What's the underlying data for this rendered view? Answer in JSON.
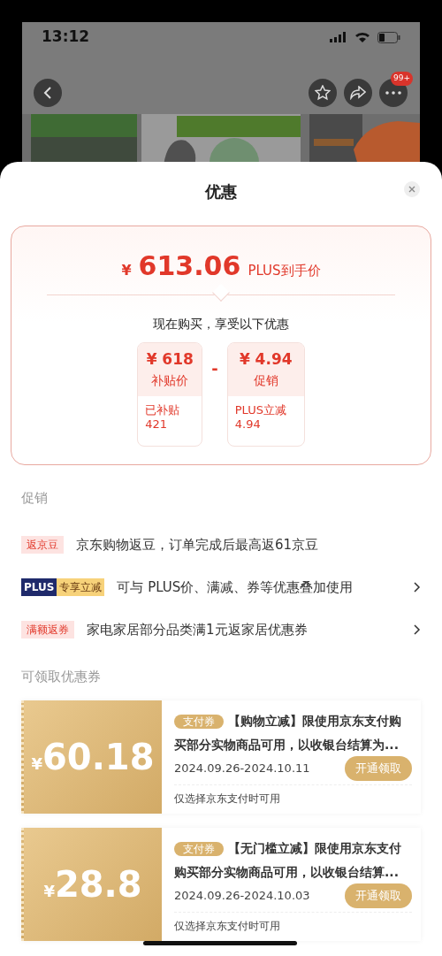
{
  "status_bar": {
    "time": "13:12"
  },
  "product_page": {
    "badge": "99+"
  },
  "sheet": {
    "title": "优惠"
  },
  "price_card": {
    "currency": "¥",
    "price": "613.06",
    "price_label": "PLUS到手价",
    "subtitle": "现在购买，享受以下优惠",
    "operator": "-",
    "items": [
      {
        "amount": "¥ 618",
        "label": "补贴价",
        "detail": "已补贴",
        "detail_value": "421"
      },
      {
        "amount": "¥ 4.94",
        "label": "促销",
        "detail": "PLUS立减",
        "detail_value": "4.94"
      }
    ]
  },
  "promotions": {
    "heading": "促销",
    "items": [
      {
        "kind": "tag",
        "tag": "返京豆",
        "text": "京东购物返豆，订单完成后最高返61京豆",
        "arrow": false
      },
      {
        "kind": "plus",
        "tag": "PLUS",
        "tag2": "专享立减",
        "text": "可与 PLUS价、满减、券等优惠叠加使用",
        "arrow": true
      },
      {
        "kind": "tag",
        "tag": "满额返券",
        "text": "家电家居部分品类满1元返家居优惠券",
        "arrow": true
      }
    ]
  },
  "coupons": {
    "heading": "可领取优惠券",
    "items": [
      {
        "currency": "¥",
        "amount": "60.18",
        "tag": "支付券",
        "title": "【购物立减】限使用京东支付购买部分实物商品可用，以收银台结算为...",
        "date": "2024.09.26-2024.10.11",
        "note": "仅选择京东支付时可用",
        "button": "开通领取"
      },
      {
        "currency": "¥",
        "amount": "28.8",
        "tag": "支付券",
        "title": "【无门槛立减】限使用京东支付购买部分实物商品可用，以收银台结算...",
        "date": "2024.09.26-2024.10.03",
        "note": "仅选择京东支付时可用",
        "button": "开通领取"
      }
    ]
  }
}
